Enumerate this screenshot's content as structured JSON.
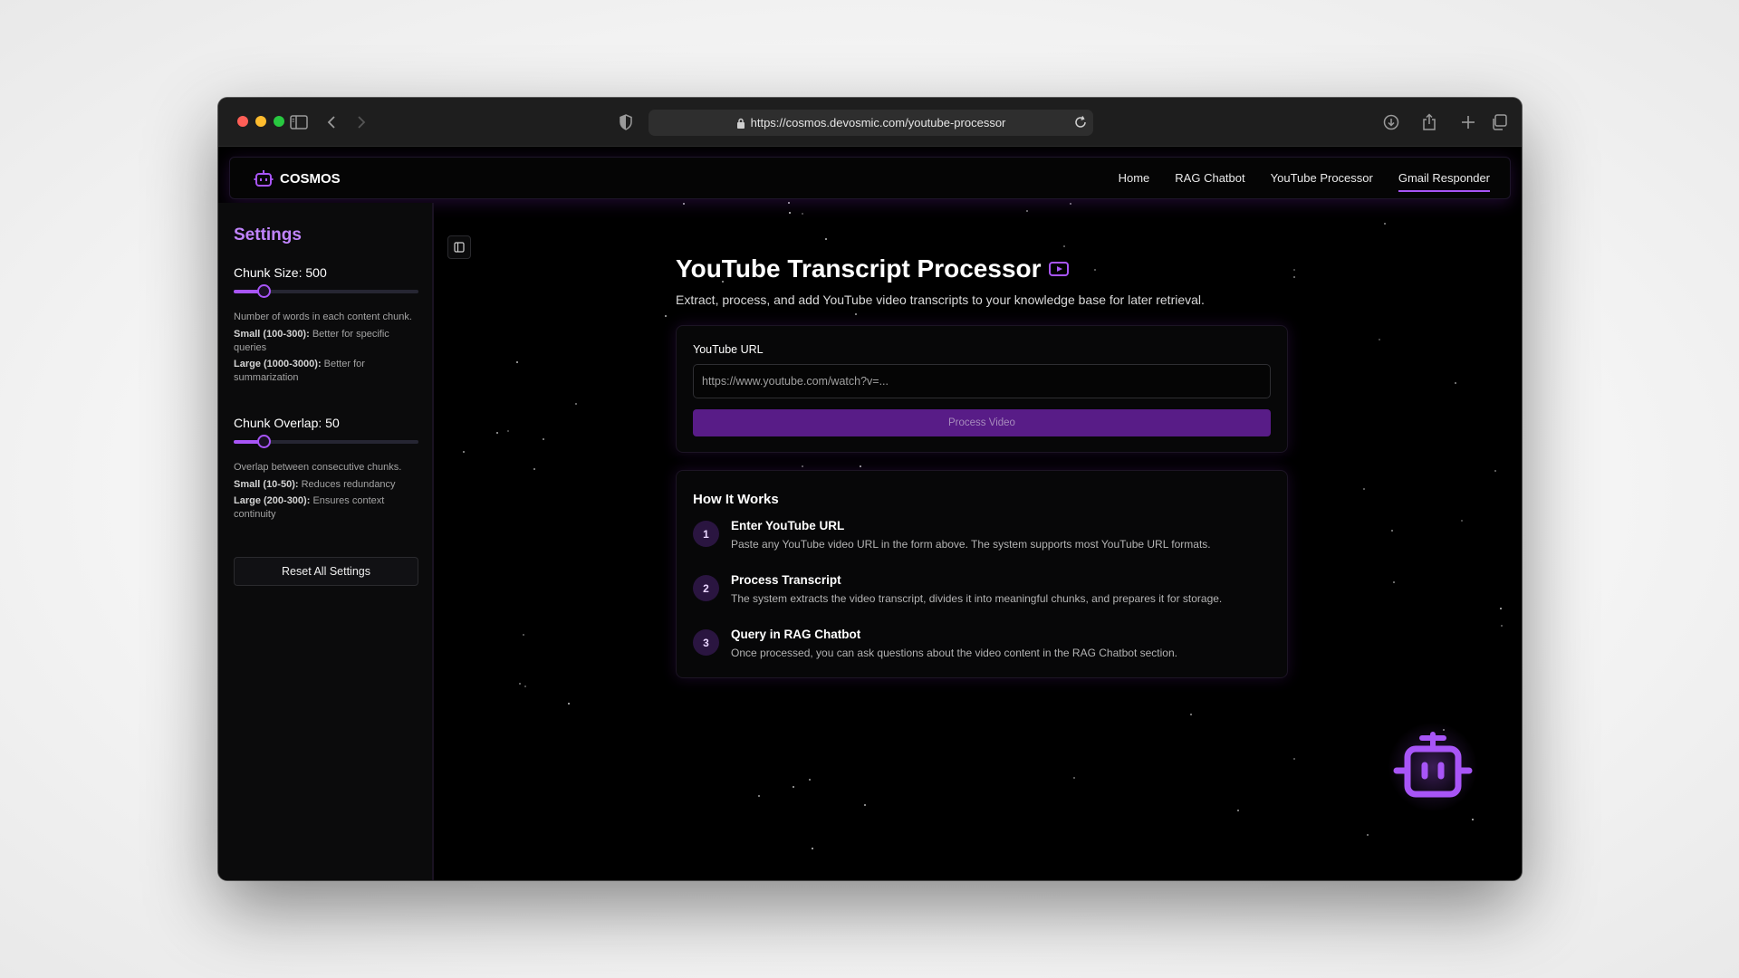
{
  "browser": {
    "url": "https://cosmos.devosmic.com/youtube-processor"
  },
  "navbar": {
    "brand": "COSMOS",
    "links": [
      "Home",
      "RAG Chatbot",
      "YouTube Processor",
      "Gmail Responder"
    ],
    "active_link": "Gmail Responder"
  },
  "sidebar": {
    "title": "Settings",
    "chunk_size": {
      "label": "Chunk Size: 500",
      "value": 500,
      "fill_fraction": 0.16,
      "description": "Number of words in each content chunk.",
      "small_label": "Small (100-300):",
      "small_text": "Better for specific queries",
      "large_label": "Large (1000-3000):",
      "large_text": "Better for summarization"
    },
    "chunk_overlap": {
      "label": "Chunk Overlap: 50",
      "value": 50,
      "fill_fraction": 0.16,
      "description": "Overlap between consecutive chunks.",
      "small_label": "Small (10-50):",
      "small_text": "Reduces redundancy",
      "large_label": "Large (200-300):",
      "large_text": "Ensures context continuity"
    },
    "reset_label": "Reset All Settings"
  },
  "main": {
    "title": "YouTube Transcript Processor",
    "subtitle": "Extract, process, and add YouTube video transcripts to your knowledge base for later retrieval.",
    "form": {
      "field_label": "YouTube URL",
      "placeholder": "https://www.youtube.com/watch?v=...",
      "button_label": "Process Video"
    },
    "how_it_works": {
      "title": "How It Works",
      "steps": [
        {
          "num": "1",
          "title": "Enter YouTube URL",
          "desc": "Paste any YouTube video URL in the form above. The system supports most YouTube URL formats."
        },
        {
          "num": "2",
          "title": "Process Transcript",
          "desc": "The system extracts the video transcript, divides it into meaningful chunks, and prepares it for storage."
        },
        {
          "num": "3",
          "title": "Query in RAG Chatbot",
          "desc": "Once processed, you can ask questions about the video content in the RAG Chatbot section."
        }
      ]
    }
  },
  "colors": {
    "accent": "#a855f7",
    "button": "#581c87",
    "settings_title": "#c084fc"
  },
  "icons": {
    "sidebar_toggle": "sidebar-icon",
    "back": "chevron-left-icon",
    "forward": "chevron-right-icon",
    "shield": "shield-icon",
    "lock": "lock-icon",
    "reload": "reload-icon",
    "download": "download-icon",
    "share": "share-icon",
    "new_tab": "plus-icon",
    "tabs": "tabs-icon",
    "brand": "robot-icon",
    "title": "video-play-icon",
    "chat_bot": "robot-icon"
  }
}
